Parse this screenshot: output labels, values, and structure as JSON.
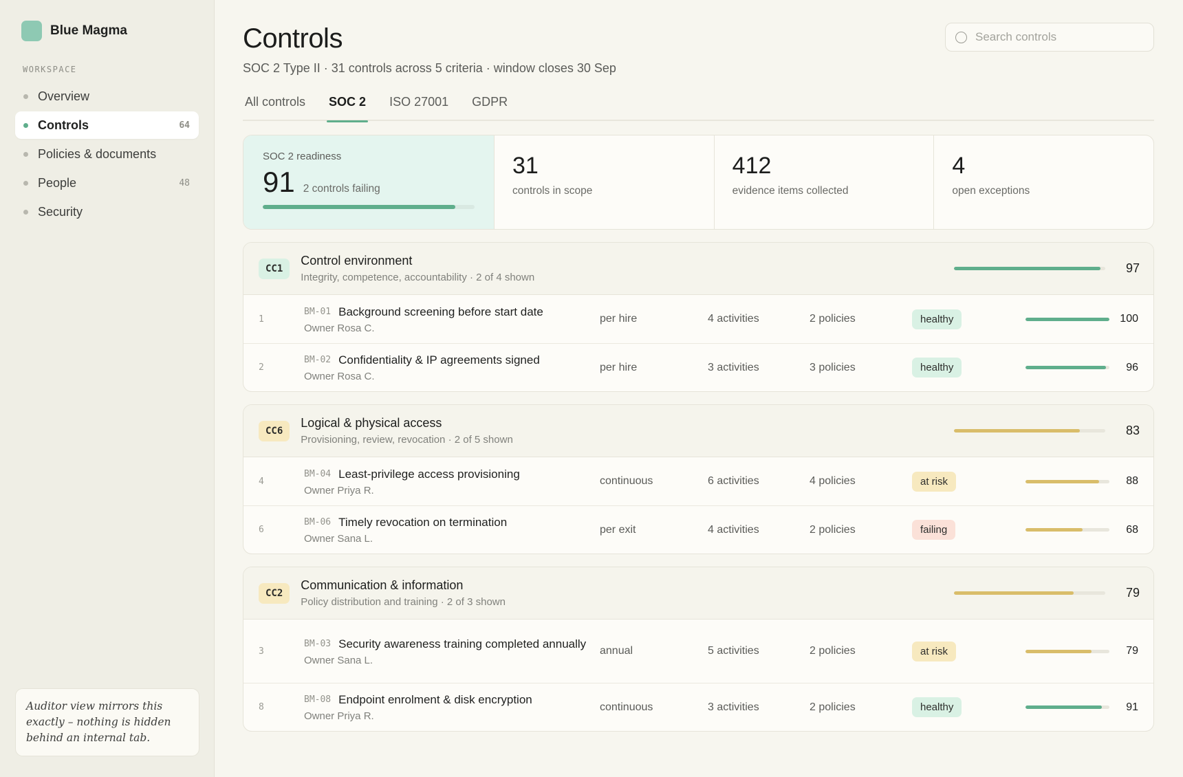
{
  "brand": {
    "name": "Blue Magma",
    "logo_color": "#8ec9b3"
  },
  "sidebar": {
    "section_label": "WORKSPACE",
    "items": [
      {
        "label": "Overview",
        "count": ""
      },
      {
        "label": "Controls",
        "count": "64",
        "active": true
      },
      {
        "label": "Policies & documents",
        "count": ""
      },
      {
        "label": "People",
        "count": "48"
      },
      {
        "label": "Security",
        "count": ""
      }
    ],
    "note": "Auditor view mirrors this exactly – nothing is hidden behind an internal tab."
  },
  "header": {
    "title": "Controls",
    "subtitle": "SOC 2 Type II · 31 controls across 5 criteria · window closes 30 Sep",
    "search_placeholder": "Search controls"
  },
  "tabs": [
    {
      "label": "All controls"
    },
    {
      "label": "SOC 2",
      "active": true
    },
    {
      "label": "ISO 27001"
    },
    {
      "label": "GDPR"
    }
  ],
  "stats": {
    "readiness": {
      "label": "SOC 2 readiness",
      "value": "91",
      "sub": "2 controls failing",
      "progress": 91
    },
    "items": [
      {
        "value": "31",
        "label": "controls in scope"
      },
      {
        "value": "412",
        "label": "evidence items collected"
      },
      {
        "value": "4",
        "label": "open exceptions"
      }
    ]
  },
  "colors": {
    "healthy": "#5fae8c",
    "warning": "#d9bd6a",
    "accent": "#5fae8c"
  },
  "groups": [
    {
      "code": "CC1",
      "tone": "green",
      "title": "Control environment",
      "subtitle": "Integrity, competence, accountability · 2 of 4 shown",
      "score": "97",
      "progress": 97,
      "bar_color": "#5fae8c",
      "rows": [
        {
          "idx": "1",
          "code": "BM-01",
          "title": "Background screening before start date",
          "owner": "Owner Rosa C.",
          "freq": "per hire",
          "activities": "4 activities",
          "policies": "2 policies",
          "status": "healthy",
          "status_class": "healthy",
          "score": "100",
          "progress": 100,
          "bar_color": "#5fae8c"
        },
        {
          "idx": "2",
          "code": "BM-02",
          "title": "Confidentiality & IP agreements signed",
          "owner": "Owner Rosa C.",
          "freq": "per hire",
          "activities": "3 activities",
          "policies": "3 policies",
          "status": "healthy",
          "status_class": "healthy",
          "score": "96",
          "progress": 96,
          "bar_color": "#5fae8c"
        }
      ]
    },
    {
      "code": "CC6",
      "tone": "yellow",
      "title": "Logical & physical access",
      "subtitle": "Provisioning, review, revocation · 2 of 5 shown",
      "score": "83",
      "progress": 83,
      "bar_color": "#d9bd6a",
      "rows": [
        {
          "idx": "4",
          "code": "BM-04",
          "title": "Least-privilege access provisioning",
          "owner": "Owner Priya R.",
          "freq": "continuous",
          "activities": "6 activities",
          "policies": "4 policies",
          "status": "at risk",
          "status_class": "risk",
          "score": "88",
          "progress": 88,
          "bar_color": "#d9bd6a"
        },
        {
          "idx": "6",
          "code": "BM-06",
          "title": "Timely revocation on termination",
          "owner": "Owner Sana L.",
          "freq": "per exit",
          "activities": "4 activities",
          "policies": "2 policies",
          "status": "failing",
          "status_class": "failing",
          "score": "68",
          "progress": 68,
          "bar_color": "#d9bd6a"
        }
      ]
    },
    {
      "code": "CC2",
      "tone": "yellow",
      "title": "Communication & information",
      "subtitle": "Policy distribution and training · 2 of 3 shown",
      "score": "79",
      "progress": 79,
      "bar_color": "#d9bd6a",
      "rows": [
        {
          "idx": "3",
          "code": "BM-03",
          "title": "Security awareness training completed annually",
          "owner": "Owner Sana L.",
          "freq": "annual",
          "activities": "5 activities",
          "policies": "2 policies",
          "status": "at risk",
          "status_class": "risk",
          "score": "79",
          "progress": 79,
          "bar_color": "#d9bd6a",
          "tall": true
        },
        {
          "idx": "8",
          "code": "BM-08",
          "title": "Endpoint enrolment & disk encryption",
          "owner": "Owner Priya R.",
          "freq": "continuous",
          "activities": "3 activities",
          "policies": "2 policies",
          "status": "healthy",
          "status_class": "healthy",
          "score": "91",
          "progress": 91,
          "bar_color": "#5fae8c"
        }
      ]
    }
  ]
}
